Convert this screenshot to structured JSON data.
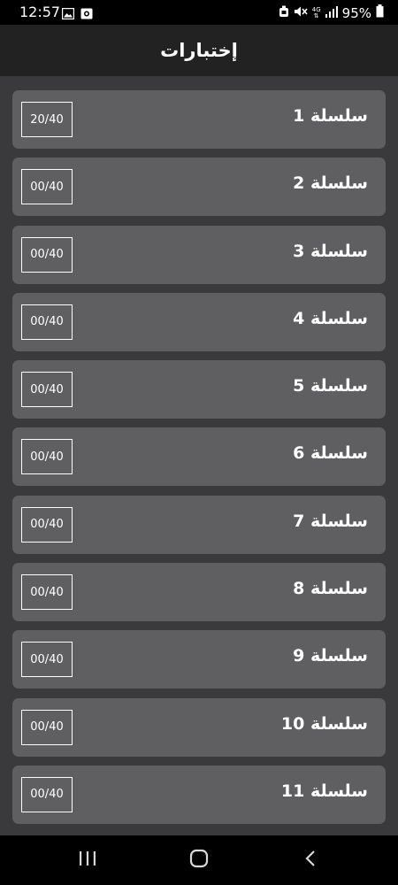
{
  "status_bar": {
    "time": "12:57",
    "battery_percent": "95%",
    "network_label": "4G"
  },
  "header": {
    "title": "إختبارات"
  },
  "series": [
    {
      "label": "سلسلة 1",
      "score": "20/40"
    },
    {
      "label": "سلسلة 2",
      "score": "00/40"
    },
    {
      "label": "سلسلة 3",
      "score": "00/40"
    },
    {
      "label": "سلسلة 4",
      "score": "00/40"
    },
    {
      "label": "سلسلة 5",
      "score": "00/40"
    },
    {
      "label": "سلسلة 6",
      "score": "00/40"
    },
    {
      "label": "سلسلة 7",
      "score": "00/40"
    },
    {
      "label": "سلسلة 8",
      "score": "00/40"
    },
    {
      "label": "سلسلة 9",
      "score": "00/40"
    },
    {
      "label": "سلسلة 10",
      "score": "00/40"
    },
    {
      "label": "سلسلة 11",
      "score": "00/40"
    }
  ],
  "colors": {
    "app_bar": "#222222",
    "content_bg": "#3a393b",
    "row_bg": "#5f5e61",
    "text": "#ffffff"
  },
  "icons": {
    "status_left": [
      "image-icon",
      "camera-icon"
    ],
    "status_right": [
      "alarm-icon",
      "mute-icon",
      "network-icon",
      "signal-icon",
      "battery-icon"
    ],
    "nav": [
      "recent-apps-icon",
      "home-icon",
      "back-icon"
    ]
  }
}
